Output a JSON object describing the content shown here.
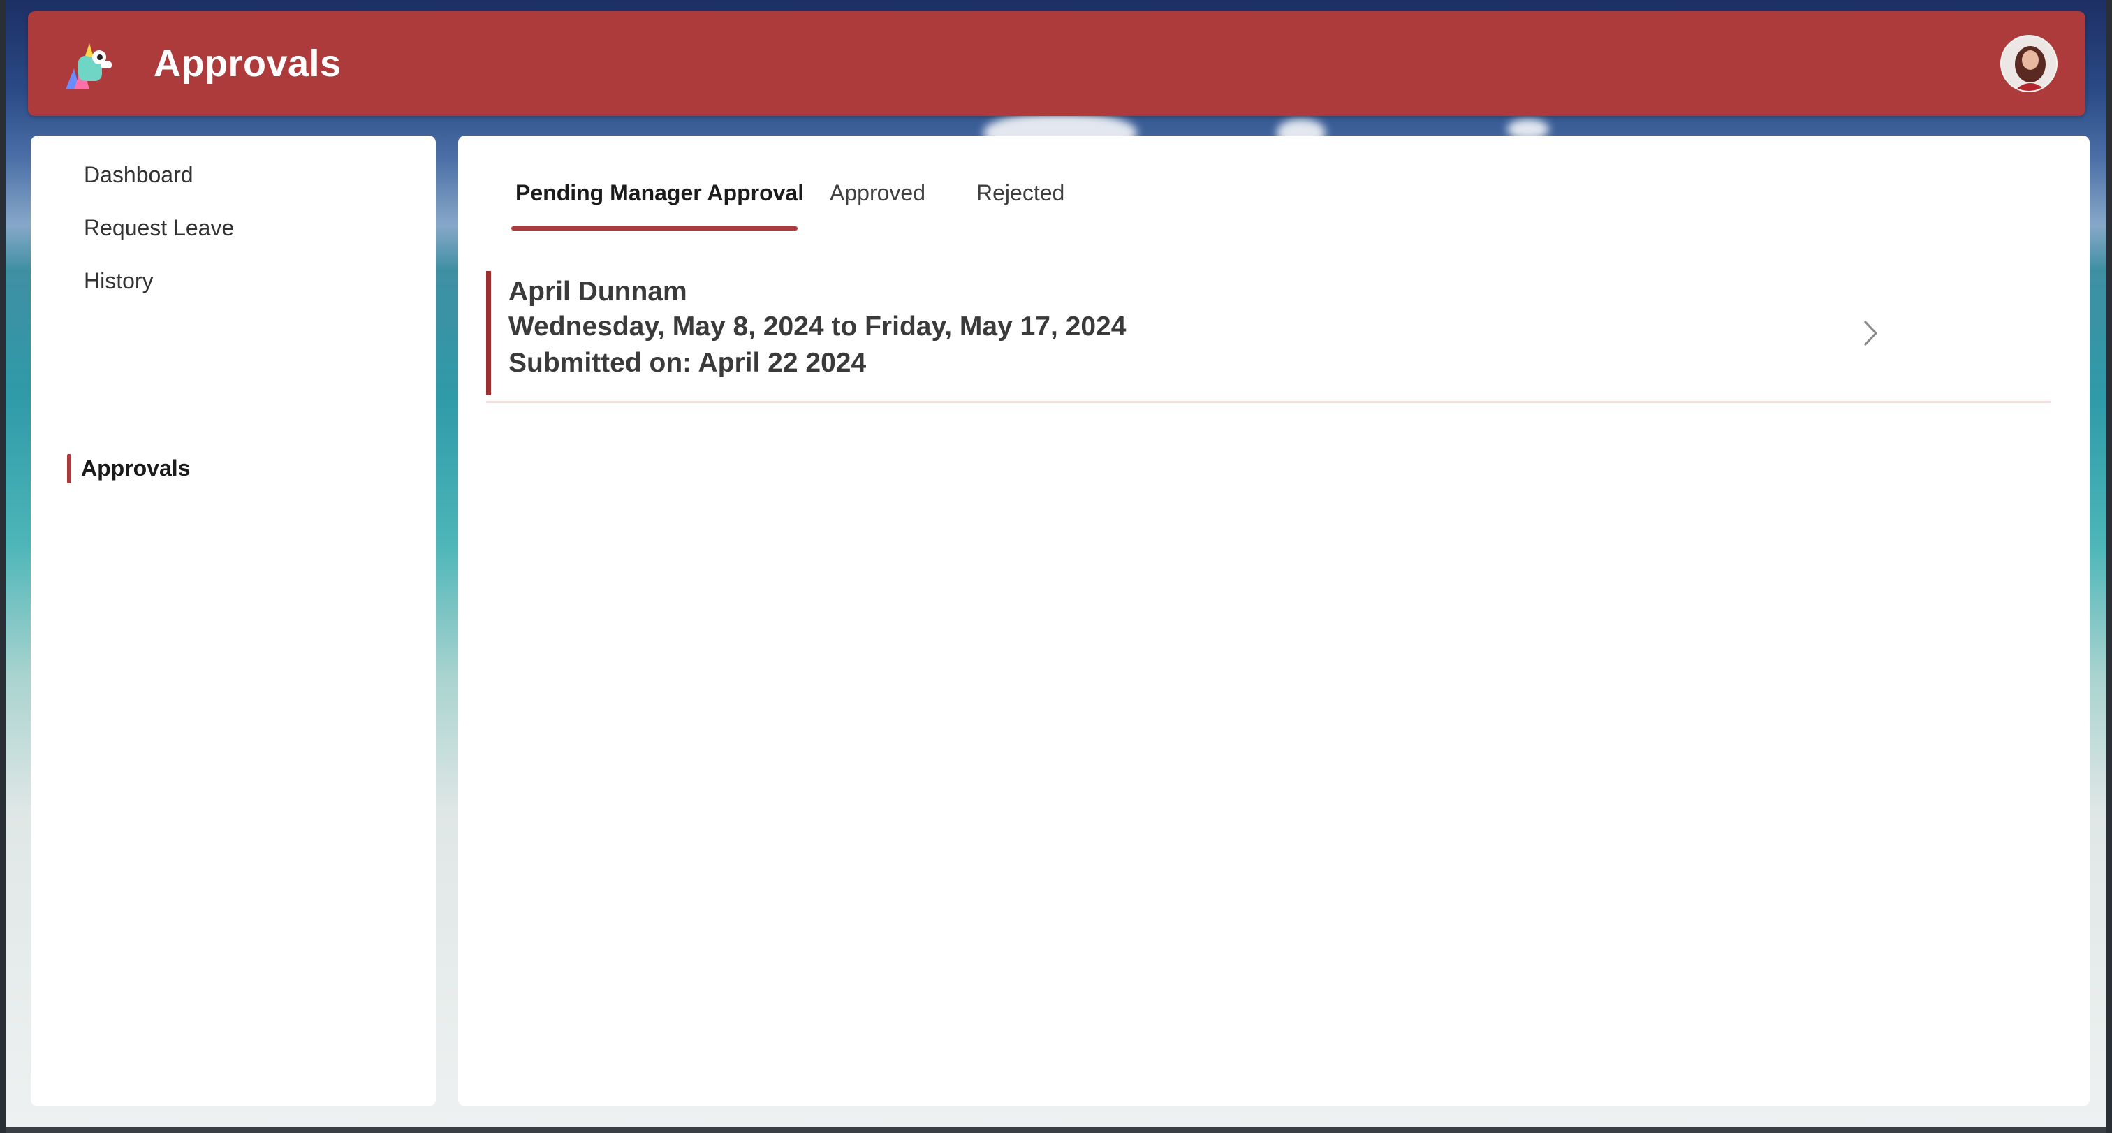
{
  "app": {
    "title": "Approvals"
  },
  "header": {
    "logo_icon": "unicorn-logo-icon",
    "avatar_icon": "user-avatar"
  },
  "sidebar": {
    "items": [
      {
        "label": "Dashboard",
        "active": false
      },
      {
        "label": "Request Leave",
        "active": false
      },
      {
        "label": "History",
        "active": false
      },
      {
        "label": "Approvals",
        "active": true
      }
    ]
  },
  "tabs": [
    {
      "label": "Pending Manager Approval",
      "active": true
    },
    {
      "label": "Approved",
      "active": false
    },
    {
      "label": "Rejected",
      "active": false
    }
  ],
  "requests": [
    {
      "name": "April Dunnam",
      "date_range": "Wednesday, May 8, 2024 to Friday, May 17, 2024",
      "submitted": "Submitted on: April 22 2024",
      "icon": "chevron-right-icon"
    }
  ],
  "colors": {
    "accent": "#ae3b3b",
    "card_bar": "#9c2f2f",
    "text": "#333333"
  }
}
